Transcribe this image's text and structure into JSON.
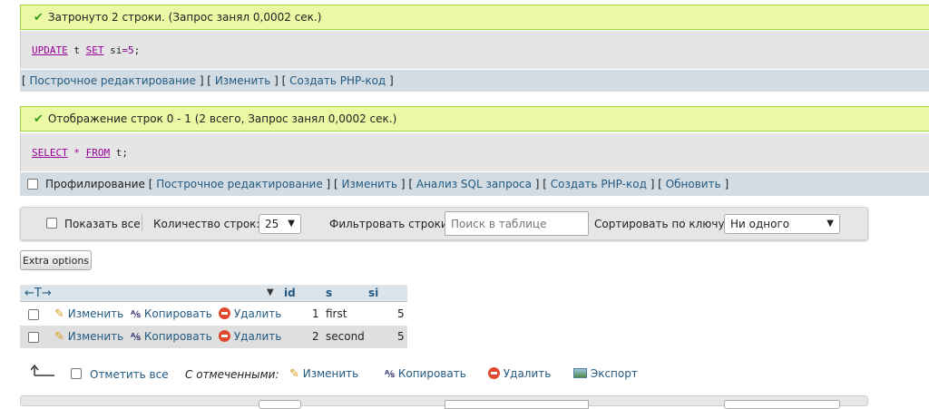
{
  "query1": {
    "message": "Затронуто 2 строки. (Запрос занял 0,0002 сек.)",
    "sql": {
      "kw1": "UPDATE",
      "t1": " t ",
      "kw2": "SET",
      "t2": " si",
      "op": "=",
      "val": "5",
      "end": ";"
    },
    "tools": {
      "open": "[ ",
      "inline_edit": "Построчное редактирование",
      "sep": " ] [ ",
      "edit": "Изменить",
      "create_php": "Создать PHP-код",
      "close": " ]"
    }
  },
  "query2": {
    "message": "Отображение строк 0 - 1 (2 всего, Запрос занял 0,0002 сек.)",
    "sql": {
      "kw1": "SELECT",
      "star": " * ",
      "kw2": "FROM",
      "t": " t;"
    },
    "tools": {
      "profiling": "Профилирование",
      "open": " [ ",
      "inline_edit": "Построчное редактирование",
      "sep": " ] [ ",
      "edit": "Изменить",
      "analyze": "Анализ SQL запроса",
      "create_php": "Создать PHP-код",
      "refresh": "Обновить",
      "close": " ]"
    }
  },
  "navbar": {
    "show_all": "Показать все",
    "rows_label": "Количество строк:",
    "rows_value": "25",
    "filter_label": "Фильтровать строки:",
    "filter_placeholder": "Поиск в таблице",
    "sort_label": "Сортировать по ключу:",
    "sort_value": "Ни одного"
  },
  "extra_options": "Extra options",
  "table": {
    "arrows": "←T→",
    "columns": [
      "id",
      "s",
      "si"
    ],
    "rows": [
      {
        "edit": "Изменить",
        "copy": "Копировать",
        "delete": "Удалить",
        "id": "1",
        "s": "first",
        "si": "5"
      },
      {
        "edit": "Изменить",
        "copy": "Копировать",
        "delete": "Удалить",
        "id": "2",
        "s": "second",
        "si": "5"
      }
    ]
  },
  "bulk": {
    "check_all": "Отметить все",
    "with_selected": "С отмеченными:",
    "edit": "Изменить",
    "copy": "Копировать",
    "delete": "Удалить",
    "export": "Экспорт"
  },
  "colors": {
    "success_bg": "#ebf8a4",
    "link": "#235a81",
    "toolbar_bg": "#d3dce3"
  }
}
